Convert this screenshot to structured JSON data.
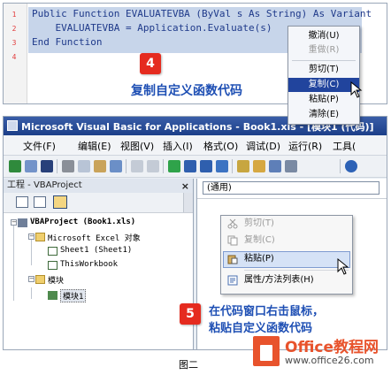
{
  "top_panel": {
    "line_numbers": [
      "1",
      "2",
      "3",
      "4"
    ],
    "code_lines": [
      "Public Function EVALUATEVBA (ByVal s As String) As Variant",
      "    EVALUATEVBA = Application.Evaluate(s)",
      "End Function"
    ],
    "context_menu": [
      {
        "label": "撤消(U)",
        "disabled": false
      },
      {
        "label": "重做(R)",
        "disabled": true
      },
      {
        "label": "剪切(T)",
        "disabled": false
      },
      {
        "label": "复制(C)",
        "disabled": false,
        "highlighted": true
      },
      {
        "label": "粘贴(P)",
        "disabled": false
      },
      {
        "label": "清除(E)",
        "disabled": false
      }
    ]
  },
  "step4": {
    "number": "4",
    "caption": "复制自定义函数代码"
  },
  "vbe": {
    "title": "Microsoft Visual Basic for Applications - Book1.xls - [模块1 (代码)]",
    "menu": [
      "文件(F)",
      "编辑(E)",
      "视图(V)",
      "插入(I)",
      "格式(O)",
      "调试(D)",
      "运行(R)",
      "工具("
    ],
    "project_pane": {
      "title": "工程 - VBAProject",
      "close": "×",
      "tree": {
        "root": "VBAProject (Book1.xls)",
        "excel_objects": "Microsoft Excel 对象",
        "sheet1": "Sheet1 (Sheet1)",
        "thisworkbook": "ThisWorkbook",
        "modules": "模块",
        "module1": "模块1"
      }
    },
    "code_window": {
      "combo": "(通用)"
    },
    "context_menu": [
      {
        "label": "剪切(T)",
        "disabled": true
      },
      {
        "label": "复制(C)",
        "disabled": true
      },
      {
        "label": "粘贴(P)",
        "disabled": false,
        "highlighted": true
      },
      {
        "label": "属性/方法列表(H)",
        "disabled": false
      }
    ]
  },
  "step5": {
    "number": "5",
    "caption_line1": "在代码窗口右击鼠标，",
    "caption_line2": "粘贴自定义函数代码"
  },
  "watermark": {
    "name": "Office教程网",
    "url": "www.office26.com"
  },
  "figure_caption": "图二",
  "colors": {
    "accent_red": "#e52b1f",
    "caption_blue": "#1e4fb4",
    "highlight": "#21449d",
    "brand_orange": "#e8532c"
  }
}
